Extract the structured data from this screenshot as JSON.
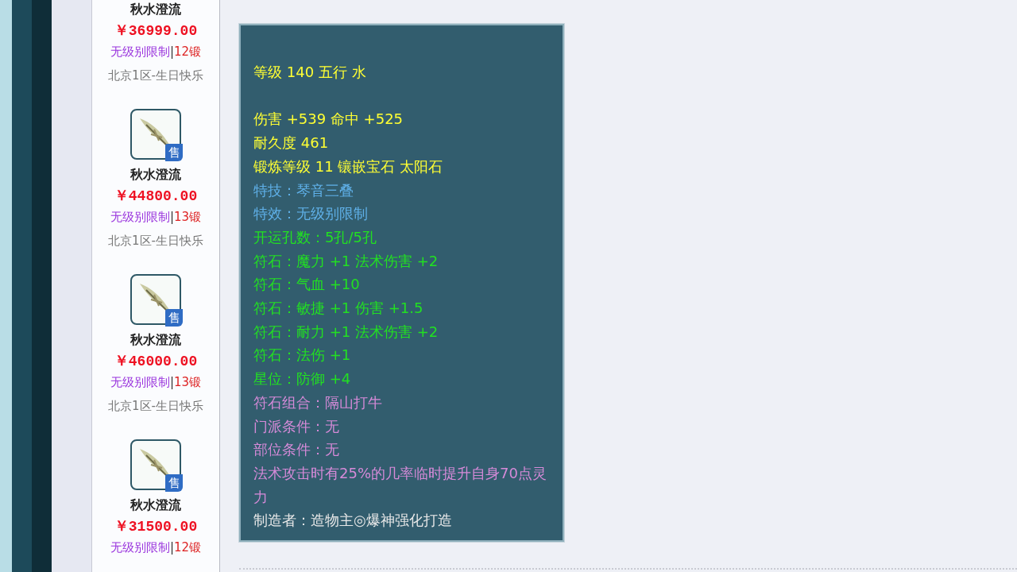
{
  "listings": [
    {
      "image": false,
      "name": "秋水澄流",
      "price": "￥36999.00",
      "level_limit": "无级别限制",
      "separator": "|",
      "forge": "12锻",
      "server": "北京1区-生日快乐"
    },
    {
      "image": true,
      "badge": "售",
      "name": "秋水澄流",
      "price": "￥44800.00",
      "level_limit": "无级别限制",
      "separator": "|",
      "forge": "13锻",
      "server": "北京1区-生日快乐"
    },
    {
      "image": true,
      "badge": "售",
      "name": "秋水澄流",
      "price": "￥46000.00",
      "level_limit": "无级别限制",
      "separator": "|",
      "forge": "13锻",
      "server": "北京1区-生日快乐"
    },
    {
      "image": true,
      "badge": "售",
      "name": "秋水澄流",
      "price": "￥31500.00",
      "level_limit": "无级别限制",
      "separator": "|",
      "forge": "12锻"
    }
  ],
  "attributes": [
    {
      "kind": "header",
      "text": "等级 140 五行 水",
      "color": "#ffff33"
    },
    {
      "kind": "line",
      "text": "伤害 +539 命中 +525",
      "color": "#ffff33"
    },
    {
      "kind": "line",
      "text": "耐久度 461",
      "color": "#ffff33"
    },
    {
      "kind": "line",
      "text": "锻炼等级 11 镶嵌宝石 太阳石",
      "color": "#ffff33"
    },
    {
      "kind": "line",
      "text": "特技：琴音三叠",
      "color": "#5fb0e8"
    },
    {
      "kind": "line",
      "text": "特效：无级别限制",
      "color": "#5fb0e8"
    },
    {
      "kind": "line",
      "text": "开运孔数：5孔/5孔",
      "color": "#22e022"
    },
    {
      "kind": "line",
      "text": "符石：魔力 +1 法术伤害 +2",
      "color": "#22e022"
    },
    {
      "kind": "line",
      "text": "符石：气血 +10",
      "color": "#22e022"
    },
    {
      "kind": "line",
      "text": "符石：敏捷 +1 伤害 +1.5",
      "color": "#22e022"
    },
    {
      "kind": "line",
      "text": "符石：耐力 +1 法术伤害 +2",
      "color": "#22e022"
    },
    {
      "kind": "line",
      "text": "符石：法伤 +1",
      "color": "#22e022"
    },
    {
      "kind": "line",
      "text": "星位：防御 +4",
      "color": "#22e022"
    },
    {
      "kind": "line",
      "text": "符石组合：隔山打牛",
      "color": "#d58ad8"
    },
    {
      "kind": "line",
      "text": "门派条件：无",
      "color": "#d58ad8"
    },
    {
      "kind": "line",
      "text": "部位条件：无",
      "color": "#d58ad8"
    },
    {
      "kind": "line",
      "text": "法术攻击时有25%的几率临时提升自身70点灵力",
      "color": "#d58ad8"
    },
    {
      "kind": "line",
      "text": "制造者：造物主◎爆神强化打造",
      "color": "#e8e8e8"
    }
  ]
}
